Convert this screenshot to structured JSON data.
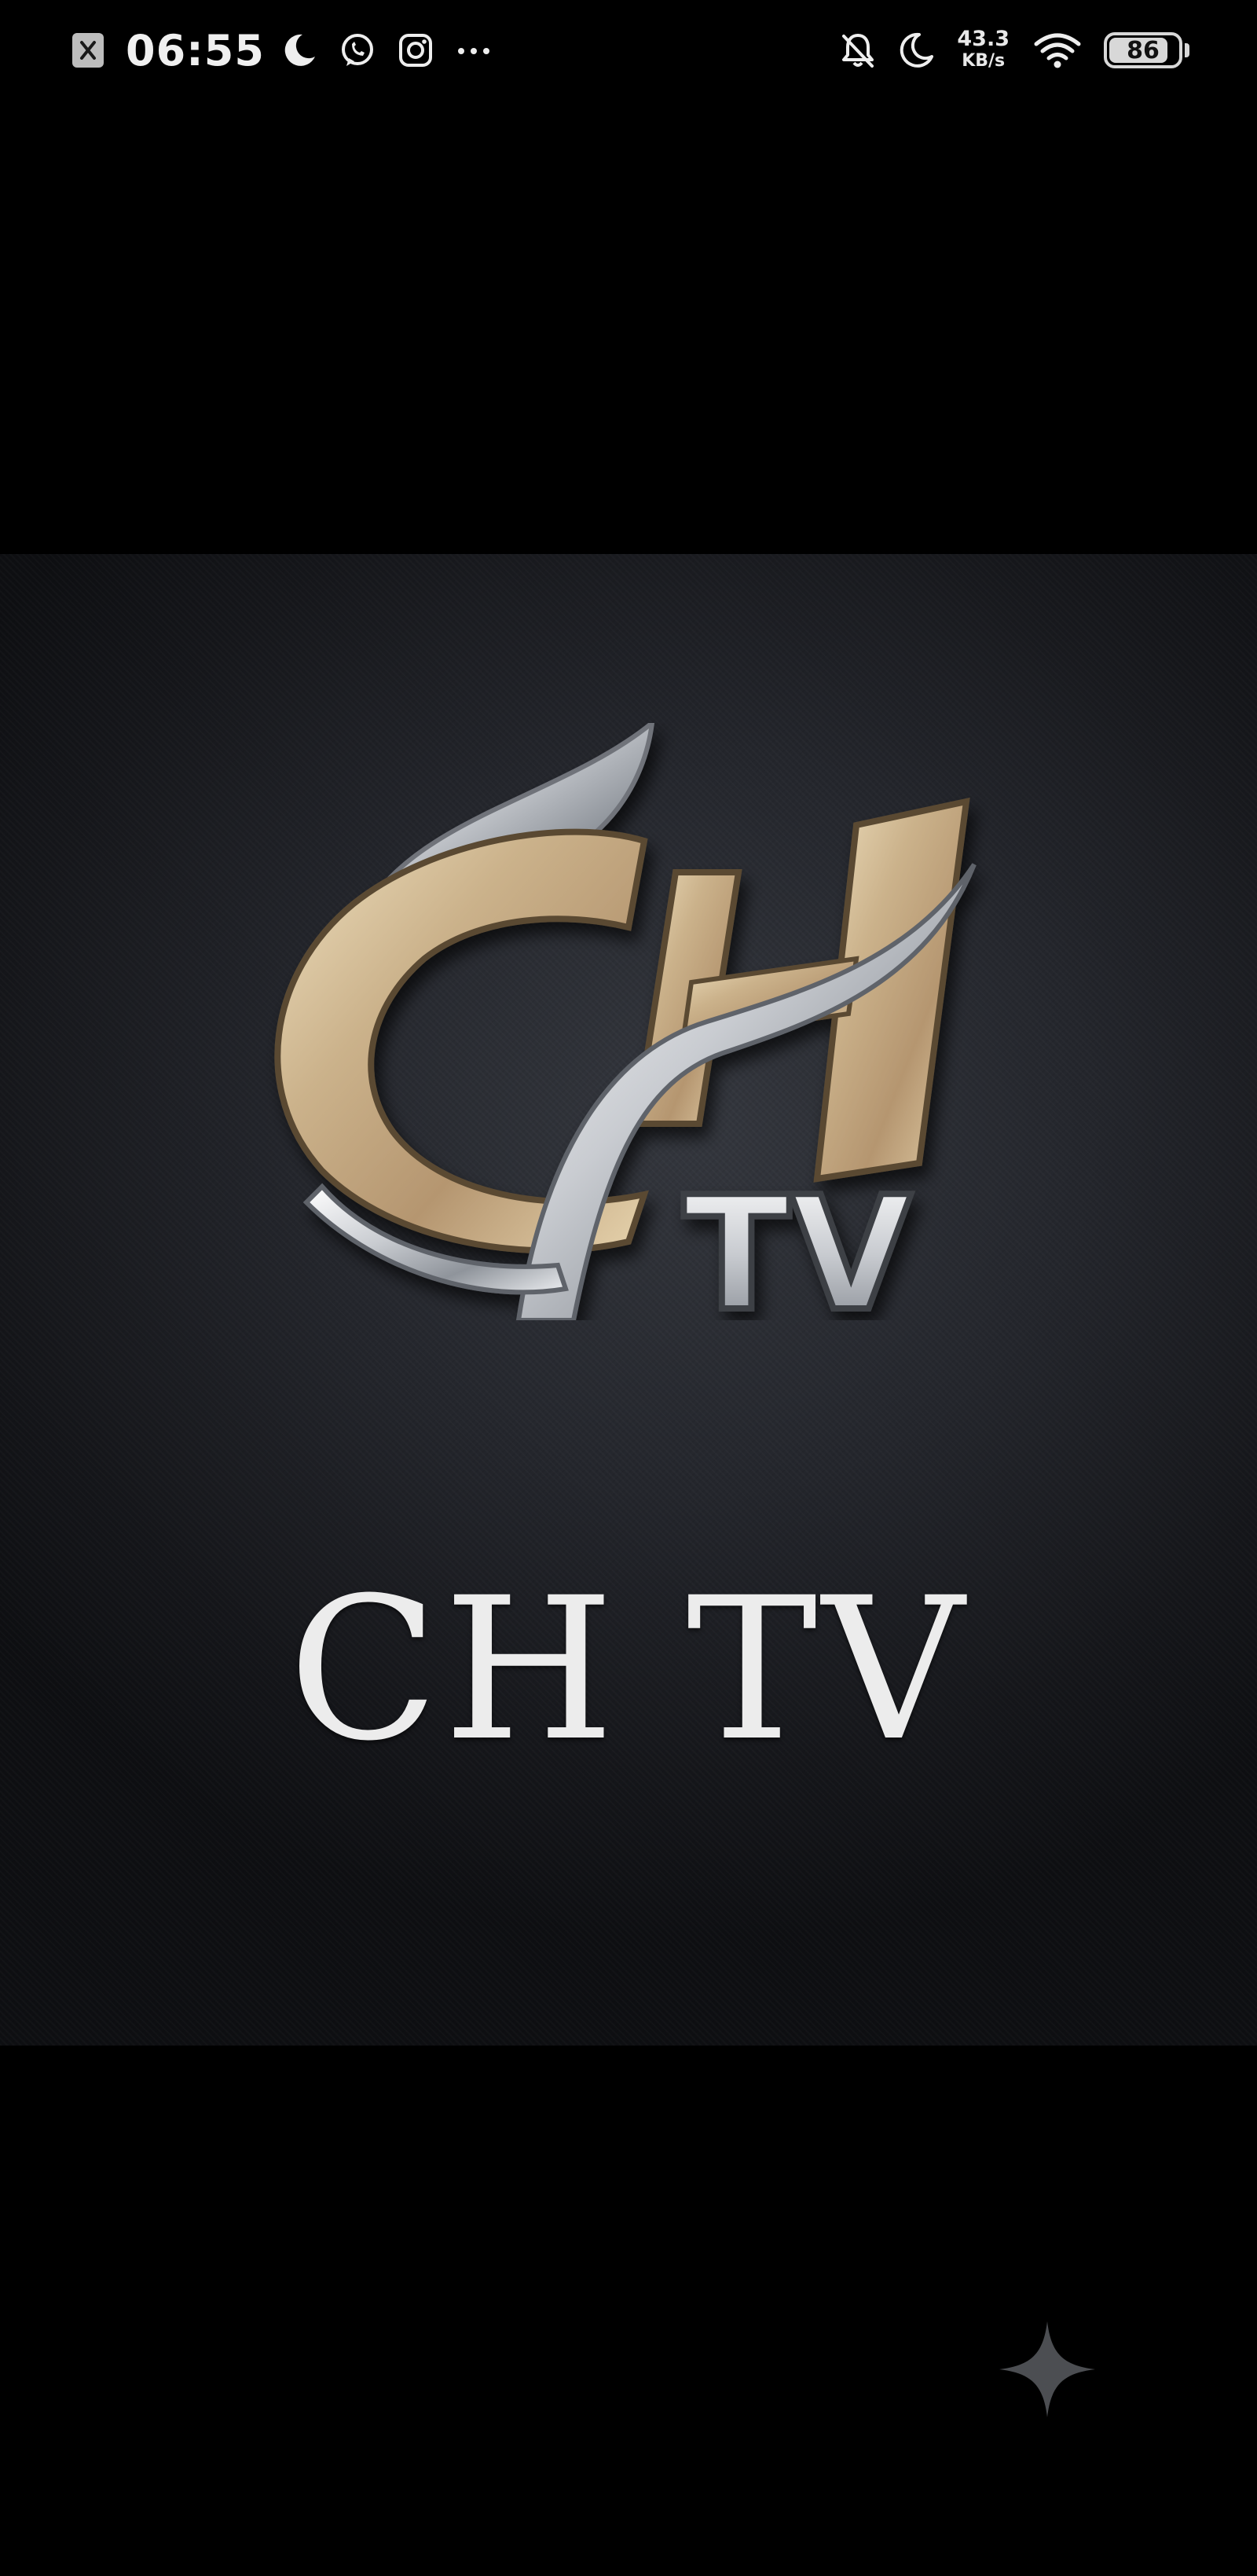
{
  "status_bar": {
    "time": "06:55",
    "network_speed_value": "43.3",
    "network_speed_unit": "KB/s",
    "battery_level": "86",
    "battery_fraction": 0.86,
    "left_icons": [
      "notification-dismissed-icon",
      "moon-icon",
      "whatsapp-icon",
      "instagram-icon",
      "more-dots-icon"
    ],
    "right_icons": [
      "bell-muted-icon",
      "moon-icon",
      "wifi-icon",
      "battery-icon"
    ]
  },
  "image": {
    "brand_title": "CH TV",
    "logo_mark_text": "CH",
    "logo_badge_text": "TV",
    "colors": {
      "gold": "#c9b088",
      "silver": "#d9dbde",
      "background": "#24262c"
    }
  },
  "floating_action": {
    "icon": "sparkle-icon"
  }
}
